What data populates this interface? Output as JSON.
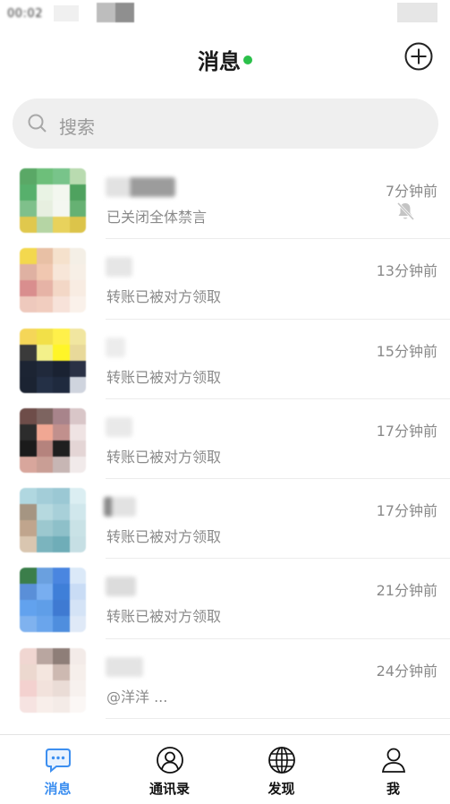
{
  "status_bar": {
    "time": "00:02"
  },
  "header": {
    "title": "消息",
    "status_color": "#2bc04a"
  },
  "search": {
    "placeholder": "搜索"
  },
  "conversations": [
    {
      "preview": "已关闭全体禁言",
      "time": "7分钟前",
      "muted": true
    },
    {
      "preview": "转账已被对方领取",
      "time": "13分钟前"
    },
    {
      "preview": "转账已被对方领取",
      "time": "15分钟前"
    },
    {
      "preview": "转账已被对方领取",
      "time": "17分钟前"
    },
    {
      "preview": "转账已被对方领取",
      "time": "17分钟前"
    },
    {
      "preview": "转账已被对方领取",
      "time": "21分钟前"
    },
    {
      "preview": "@洋洋 ...",
      "time": "24分钟前"
    }
  ],
  "tabbar": {
    "active_color": "#3d8ff0",
    "tabs": [
      {
        "label": "消息",
        "icon": "chat-bubble-icon",
        "active": true
      },
      {
        "label": "通讯录",
        "icon": "contacts-icon"
      },
      {
        "label": "发现",
        "icon": "globe-icon"
      },
      {
        "label": "我",
        "icon": "profile-icon"
      }
    ]
  }
}
